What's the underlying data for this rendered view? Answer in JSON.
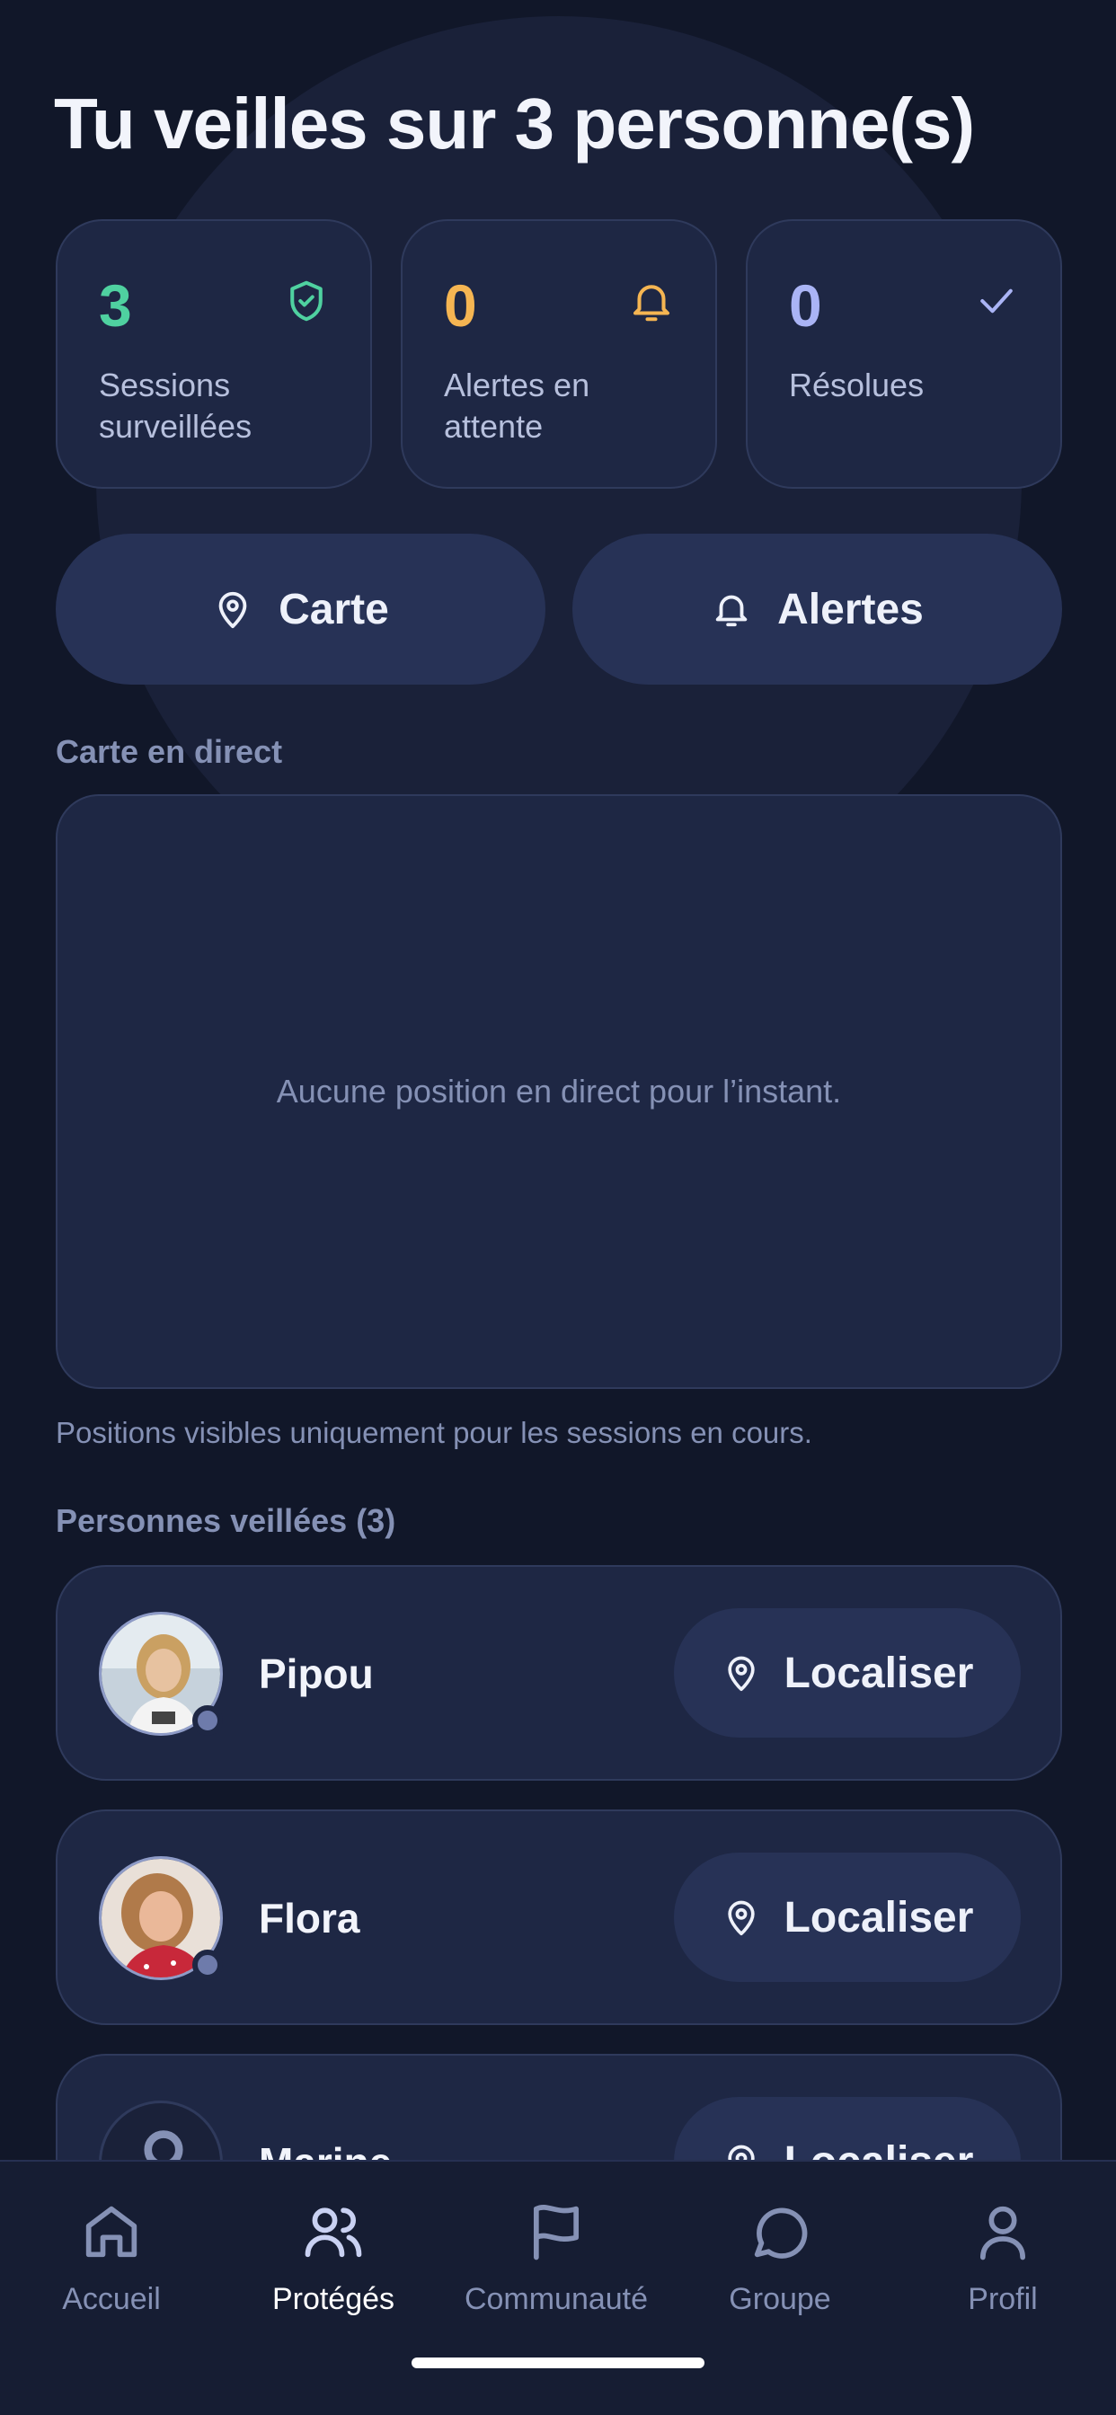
{
  "header": {
    "title": "Tu veilles sur 3 personne(s)"
  },
  "stats": [
    {
      "value": "3",
      "label": "Sessions surveillées",
      "icon": "shield-check-icon",
      "color": "#4fd1a0"
    },
    {
      "value": "0",
      "label": "Alertes en attente",
      "icon": "bell-icon",
      "color": "#f5b552"
    },
    {
      "value": "0",
      "label": "Résolues",
      "icon": "check-icon",
      "color": "#aab4f5"
    }
  ],
  "actions": {
    "map_label": "Carte",
    "alerts_label": "Alertes"
  },
  "live_map": {
    "section_title": "Carte en direct",
    "empty_message": "Aucune position en direct pour l’instant.",
    "note": "Positions visibles uniquement pour les sessions en cours."
  },
  "protected": {
    "section_title": "Personnes veillées (3)",
    "locate_label": "Localiser",
    "people": [
      {
        "name": "Pipou"
      },
      {
        "name": "Flora"
      },
      {
        "name": "Marine"
      }
    ]
  },
  "tabbar": {
    "items": [
      {
        "label": "Accueil",
        "icon": "home-icon"
      },
      {
        "label": "Protégés",
        "icon": "users-icon",
        "active": true
      },
      {
        "label": "Communauté",
        "icon": "flag-icon"
      },
      {
        "label": "Groupe",
        "icon": "chat-bubble-icon"
      },
      {
        "label": "Profil",
        "icon": "user-icon"
      }
    ]
  }
}
